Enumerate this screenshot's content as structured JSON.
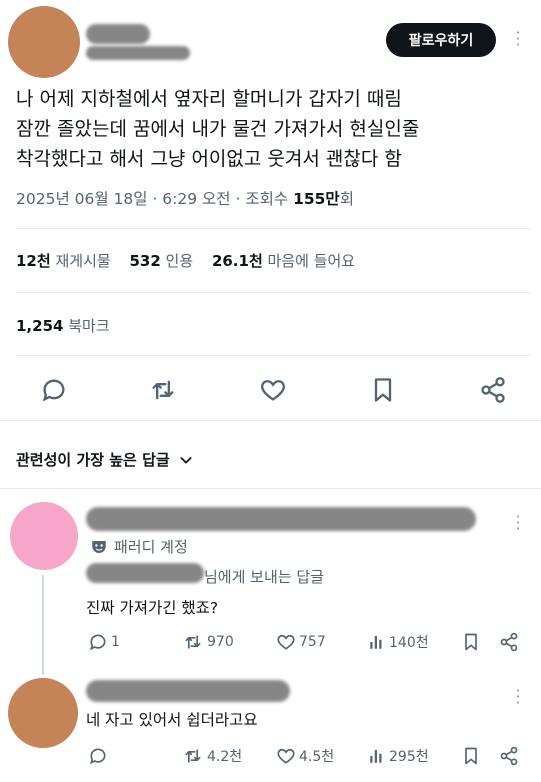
{
  "main_post": {
    "follow_label": "팔로우하기",
    "text_lines": [
      "나 어제 지하철에서 옆자리 할머니가 갑자기 때림",
      "잠깐 졸았는데 꿈에서 내가 물건 가져가서 현실인줄",
      "착각했다고 해서 그냥 어이없고 웃겨서 괜찮다 함"
    ],
    "timestamp": "2025년 06월 18일 · 6:29 오전 · 조회수 ",
    "views": "155만",
    "views_suffix": "회",
    "stats": {
      "reposts_count": "12천",
      "reposts_label": "재게시물",
      "quotes_count": "532",
      "quotes_label": "인용",
      "likes_count": "26.1천",
      "likes_label": "마음에 들어요"
    },
    "bookmarks_count": "1,254",
    "bookmarks_label": "북마크"
  },
  "replies_header": {
    "sort_label": "관련성이 가장 높은 답글"
  },
  "replies": [
    {
      "avatar_color": "#f6a6c8",
      "parody_label": "패러디 계정",
      "reply_to_suffix": "님에게 보내는 답글",
      "text": "진짜 가져가긴 했죠?",
      "comments": "1",
      "reposts": "970",
      "likes": "757",
      "views": "140천"
    },
    {
      "avatar_color": "#c48458",
      "text": "네 자고 있어서 쉽더라고요",
      "comments": "",
      "reposts": "4.2천",
      "likes": "4.5천",
      "views": "295천"
    }
  ],
  "colors": {
    "main_avatar": "#c48458",
    "text": "#0f1419",
    "secondary": "#536471"
  }
}
